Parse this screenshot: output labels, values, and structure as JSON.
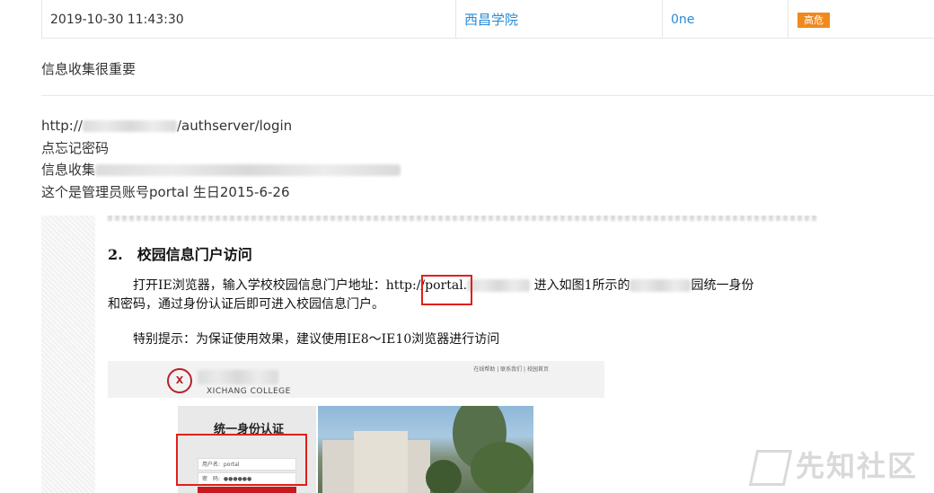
{
  "record": {
    "date": "2019-10-30 11:43:30",
    "school": "西昌学院",
    "user": "0ne",
    "severity": "高危",
    "severity_color": "#f0891e",
    "link_color": "#2a8bd6"
  },
  "post": {
    "title": "信息收集很重要",
    "lines": [
      {
        "prefix": "http://",
        "suffix": "/authserver/login"
      },
      {
        "text": "点忘记密码"
      },
      {
        "prefix": "信息收集",
        "suffix": ""
      },
      {
        "text": "这个是管理员账号portal 生日2015-6-26"
      }
    ]
  },
  "document": {
    "heading": "2. 校园信息门户访问",
    "para1_a": "打开IE浏览器，输入学校校园信息门户地址：http://",
    "para1_portal": "portal.",
    "para1_b": " 进入如图1所示的",
    "para1_c": "园统一身份",
    "para1_d": "和密码，通过身份认证后即可进入校园信息门户。",
    "para2": "特别提示：为保证使用效果，建议使用IE8～IE10浏览器进行访问",
    "screenshot": {
      "college": "XICHANG COLLEGE",
      "top_links": "在线帮助 | 联系我们 | 校园首页",
      "login_title": "统一身份认证",
      "username_label": "用户名:",
      "username_value": "portal",
      "password_label": "密　码:",
      "password_value": "●●●●●●"
    }
  },
  "watermark": "先知社区"
}
